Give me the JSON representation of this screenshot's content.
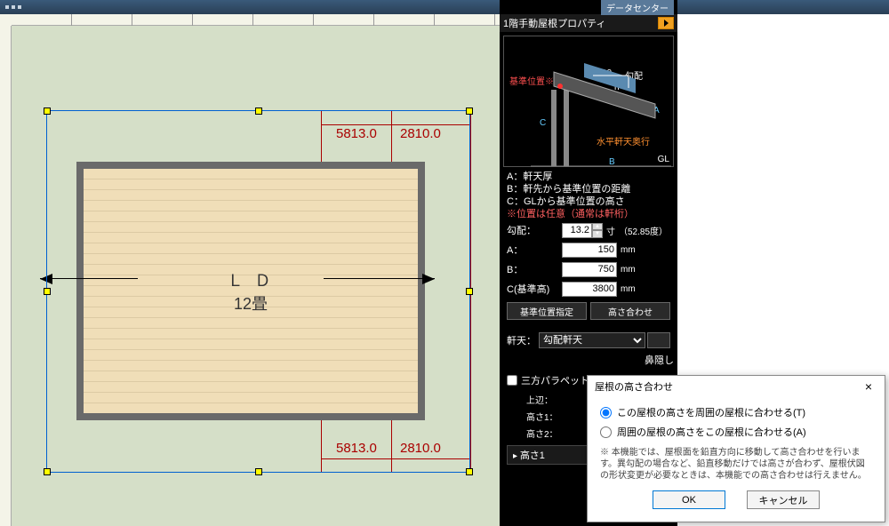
{
  "topbar": {
    "datacenter": "データセンター"
  },
  "canvas": {
    "dims": {
      "d1": "5813.0",
      "d2": "2810.0",
      "d3": "5813.0",
      "d4": "2810.0"
    },
    "room": {
      "label": "Ｌ Ｄ",
      "size": "12畳"
    }
  },
  "panel": {
    "title": "1階手動屋根プロパティ",
    "diagram": {
      "ref_pos": "基準位置※",
      "slope_num": "10",
      "slope_lbl": "勾配",
      "n": "n",
      "A": "A",
      "B": "B",
      "C": "C",
      "horiz": "水平軒天奥行",
      "gl": "GL"
    },
    "legend": {
      "a": "A：軒天厚",
      "b": "B：軒先から基準位置の距離",
      "c": "C：GLから基準位置の高さ",
      "note": "※位置は任意（通常は軒桁）"
    },
    "props": {
      "slope_lbl": "勾配：",
      "slope_val": "13.2",
      "slope_unit": "寸",
      "slope_deg": "（52.85度）",
      "a_lbl": "A：",
      "a_val": "150",
      "a_unit": "mm",
      "b_lbl": "B：",
      "b_val": "750",
      "b_unit": "mm",
      "c_lbl": "C(基準高)",
      "c_val": "3800",
      "c_unit": "mm"
    },
    "buttons": {
      "ref": "基準位置指定",
      "height": "高さ合わせ"
    },
    "eaves": {
      "lbl": "軒天：",
      "value": "勾配軒天",
      "hide": "鼻隠し"
    },
    "parapet": "三方パラペット",
    "upper": "上辺：",
    "h1": "高さ1：",
    "h2": "高さ2：",
    "collapse": "高さ1"
  },
  "dialog": {
    "title": "屋根の高さ合わせ",
    "opt1": "この屋根の高さを周囲の屋根に合わせる(T)",
    "opt2": "周囲の屋根の高さをこの屋根に合わせる(A)",
    "note": "※ 本機能では、屋根面を鉛直方向に移動して高さ合わせを行います。異勾配の場合など、鉛直移動だけでは高さが合わず、屋根伏図の形状変更が必要なときは、本機能での高さ合わせは行えません。",
    "ok": "OK",
    "cancel": "キャンセル"
  },
  "chart_data": {
    "type": "table",
    "title": "1階手動屋根プロパティ",
    "rows": [
      {
        "param": "勾配",
        "value": 13.2,
        "unit": "寸",
        "note": "52.85度"
      },
      {
        "param": "A 軒天厚",
        "value": 150,
        "unit": "mm"
      },
      {
        "param": "B 軒先から基準位置の距離",
        "value": 750,
        "unit": "mm"
      },
      {
        "param": "C GLから基準位置の高さ",
        "value": 3800,
        "unit": "mm"
      }
    ]
  }
}
